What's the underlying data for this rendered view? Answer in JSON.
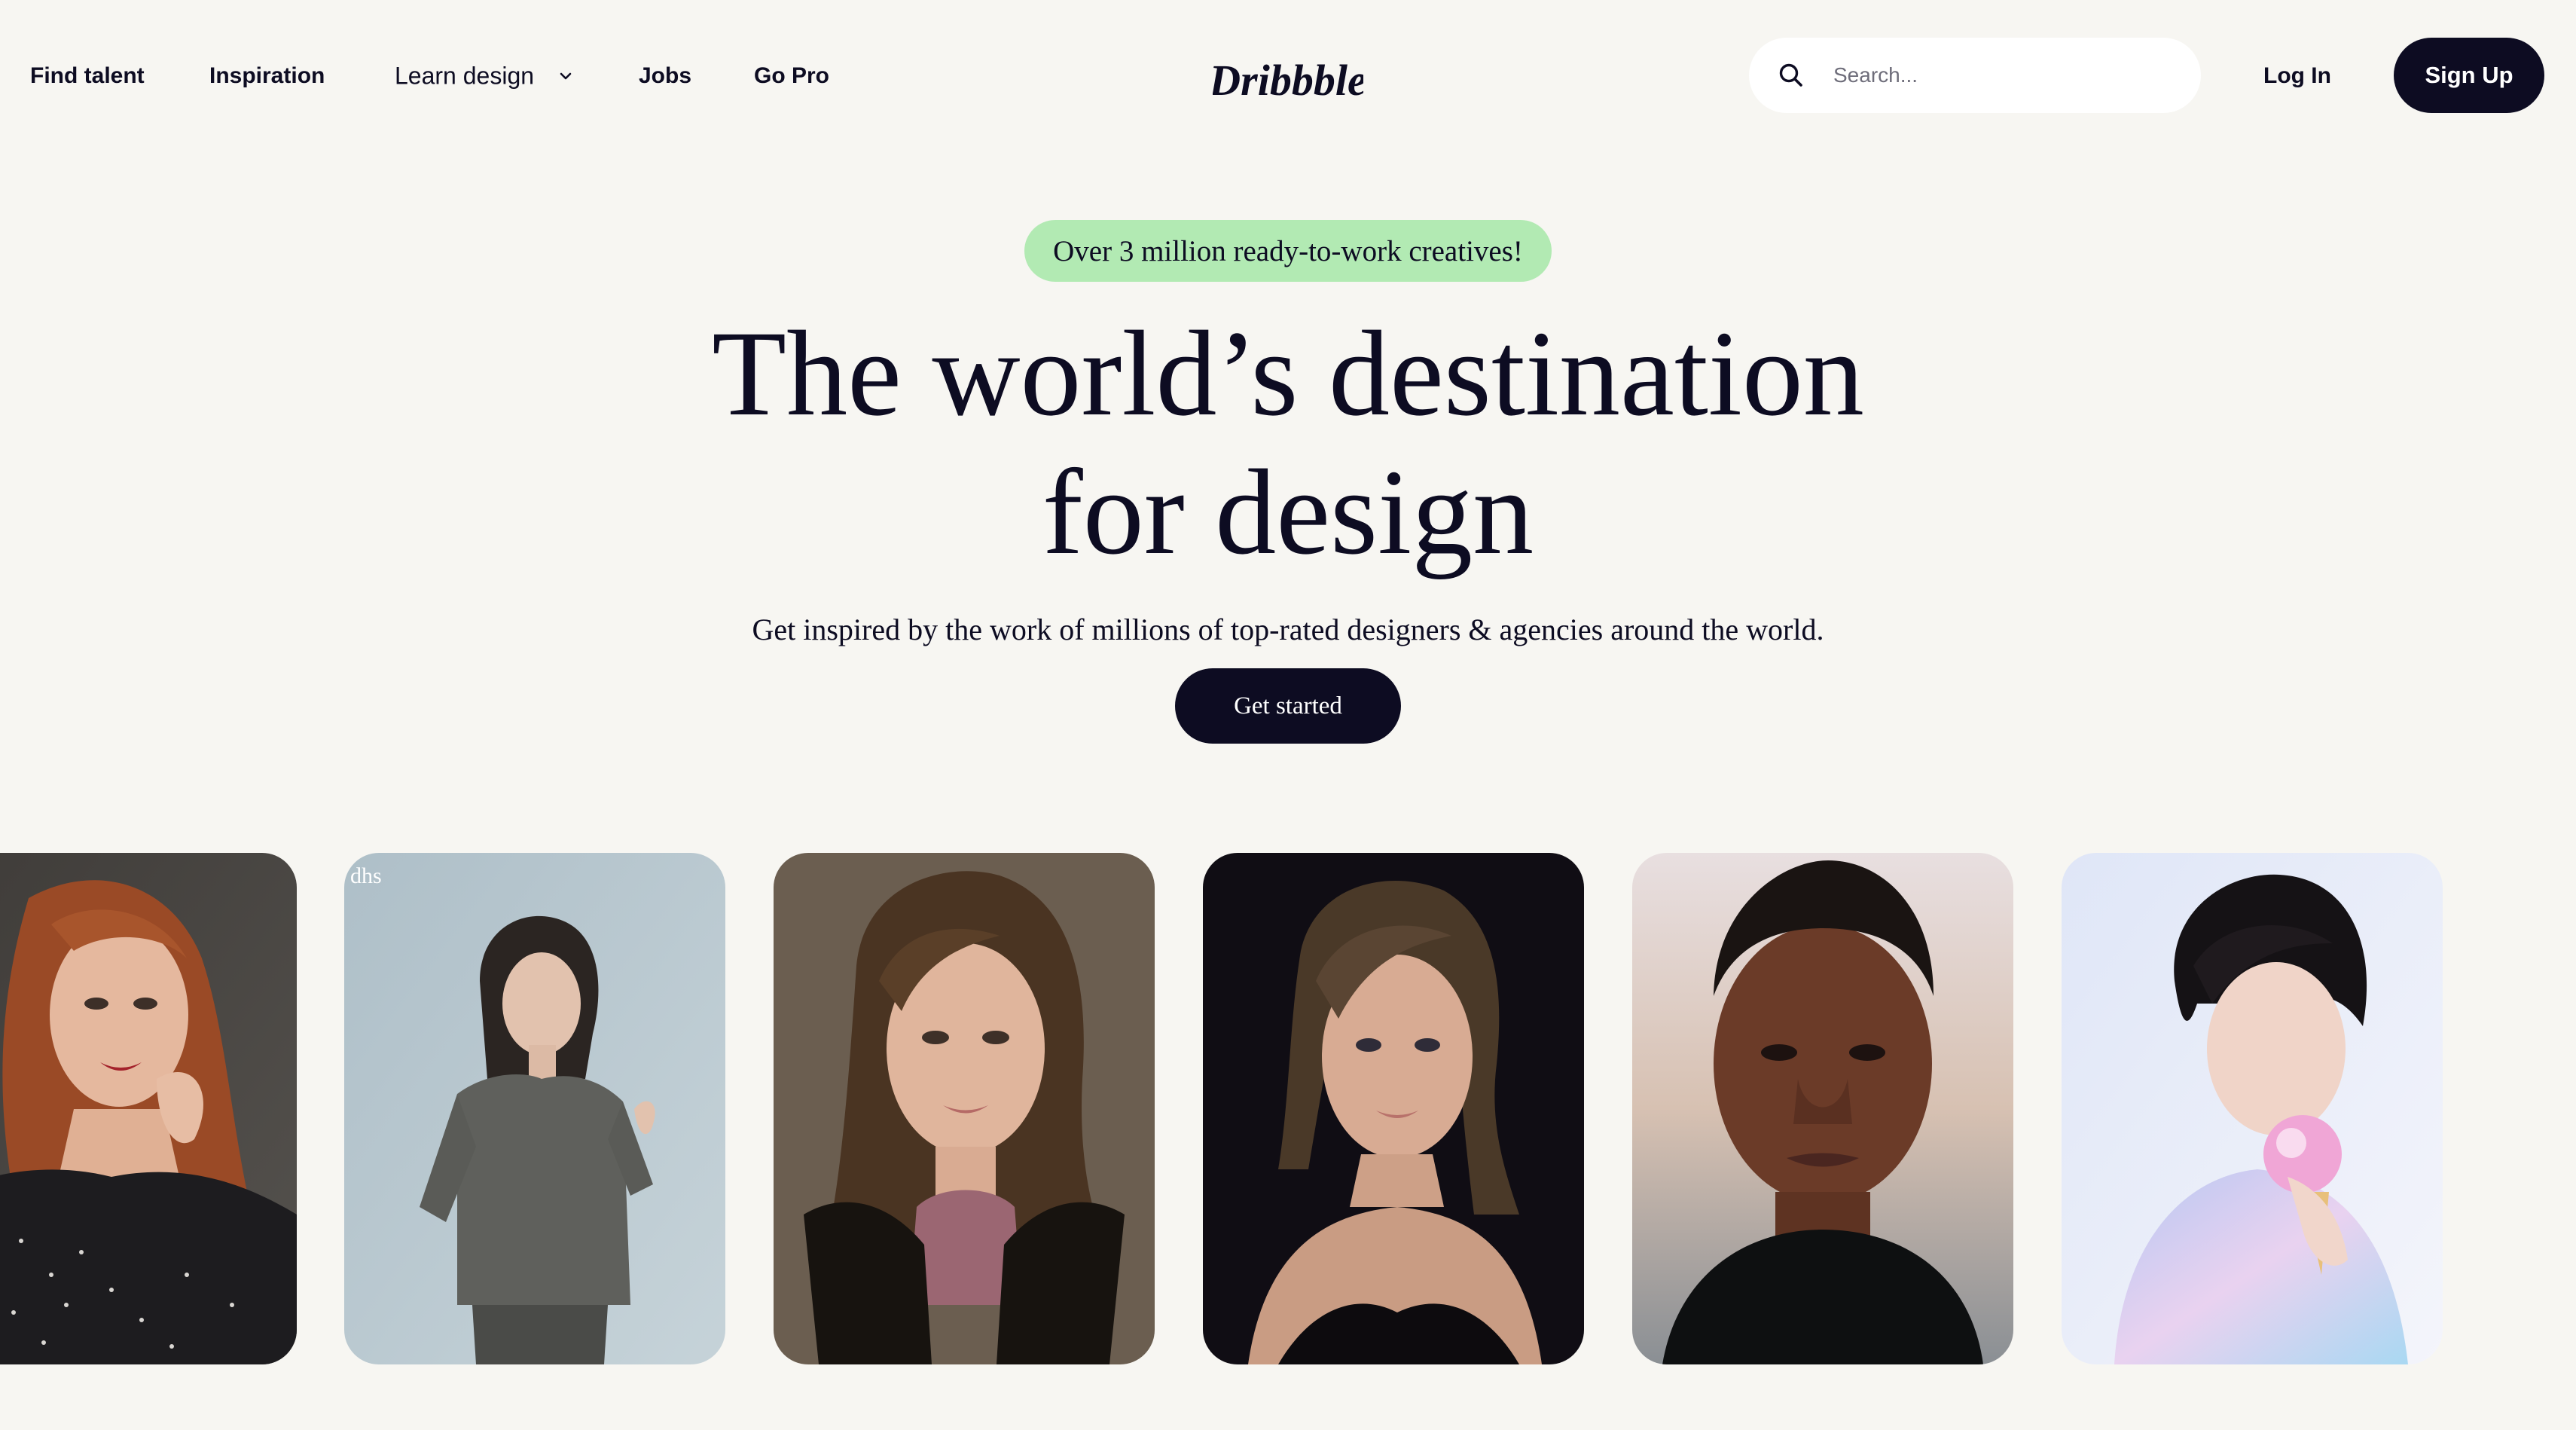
{
  "header": {
    "nav": {
      "find_talent": "Find talent",
      "inspiration": "Inspiration",
      "learn_design": "Learn design",
      "jobs": "Jobs",
      "go_pro": "Go Pro"
    },
    "logo_text": "Dribbble",
    "search": {
      "placeholder": "Search..."
    },
    "login_label": "Log In",
    "signup_label": "Sign Up"
  },
  "hero": {
    "badge": "Over 3 million ready-to-work creatives!",
    "title_line1": "The world’s destination",
    "title_line2": "for design",
    "subtitle": "Get inspired by the work of millions of top-rated designers & agencies around the world.",
    "cta_label": "Get started"
  },
  "cards": [
    {
      "caption": ""
    },
    {
      "caption": "dhs"
    },
    {
      "caption": ""
    },
    {
      "caption": ""
    },
    {
      "caption": ""
    },
    {
      "caption": ""
    }
  ],
  "colors": {
    "background": "#f7f6f2",
    "text": "#0d0c22",
    "badge": "#b2eab3",
    "button": "#0d0c22"
  }
}
